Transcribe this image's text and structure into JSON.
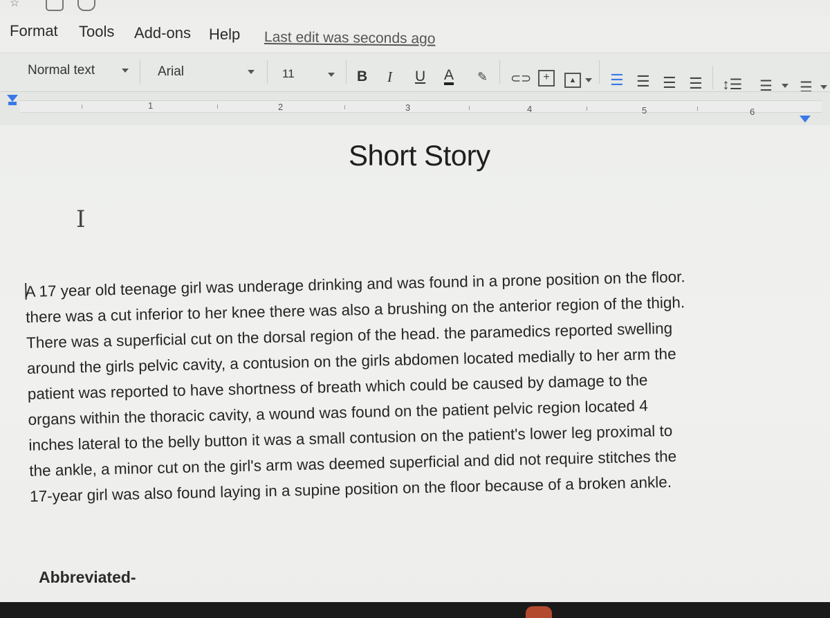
{
  "menu": {
    "items": [
      "Format",
      "Tools",
      "Add-ons",
      "Help"
    ],
    "last_edit": "Last edit was seconds ago"
  },
  "toolbar": {
    "style_value": "Normal text",
    "font_value": "Arial",
    "size_value": "11",
    "bold": "B",
    "italic": "I",
    "underline": "U",
    "text_color": "A",
    "icons": [
      "highlight-icon",
      "link-icon",
      "comment-icon",
      "image-icon",
      "align-left-icon",
      "align-center-icon",
      "align-right-icon",
      "align-justify-icon",
      "line-spacing-icon",
      "numbered-list-icon",
      "bulleted-list-icon"
    ]
  },
  "ruler": {
    "numbers": [
      "1",
      "2",
      "3",
      "4",
      "5",
      "6"
    ]
  },
  "document": {
    "title": "Short Story",
    "lines": [
      "A 17 year old teenage girl was underage drinking and was found in a prone position on the floor.",
      "there was a cut inferior to her knee there was also a brushing on the anterior region of the thigh.",
      "There was a superficial cut on the dorsal region of the head.  the paramedics reported swelling",
      "around the girls pelvic cavity, a contusion on the girls abdomen located medially to her arm the",
      "patient was reported to have shortness of breath which could be caused by damage to the",
      "organs within the thoracic cavity, a wound was found on the patient pelvic region located 4",
      "inches lateral to the belly button it was a small contusion on the patient's lower leg proximal to",
      "the ankle, a minor cut on the girl's arm was deemed superficial and did not require stitches the",
      "17-year girl was also found laying in a supine position on the floor because of a broken ankle."
    ],
    "footer_label": "Abbreviated-"
  }
}
